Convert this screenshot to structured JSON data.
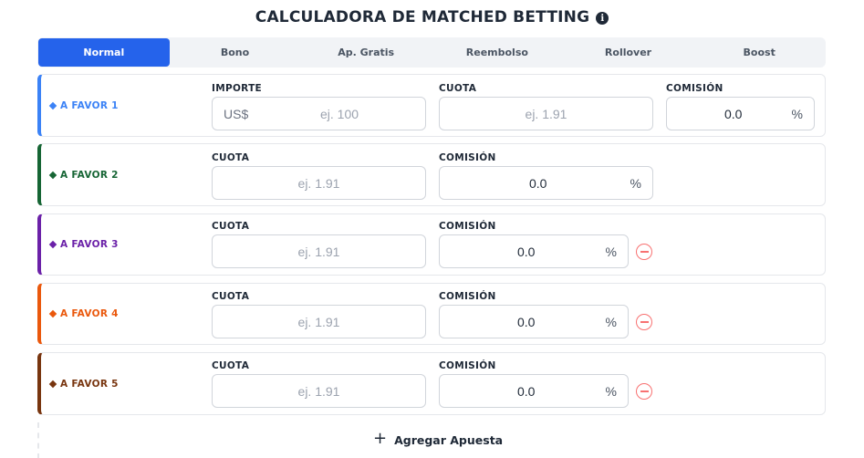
{
  "header": {
    "title": "CALCULADORA DE MATCHED BETTING",
    "info_icon": "info-icon"
  },
  "tabs": [
    {
      "label": "Normal",
      "active": true
    },
    {
      "label": "Bono",
      "active": false
    },
    {
      "label": "Ap. Gratis",
      "active": false
    },
    {
      "label": "Reembolso",
      "active": false
    },
    {
      "label": "Rollover",
      "active": false
    },
    {
      "label": "Boost",
      "active": false
    }
  ],
  "rows": [
    {
      "label": "A FAVOR 1",
      "color": "#3b82f6",
      "labels": {
        "importe": "IMPORTE",
        "cuota": "CUOTA",
        "comision": "COMISIÓN"
      },
      "currency": "US$",
      "importe_placeholder": "ej. 100",
      "cuota_placeholder": "ej. 1.91",
      "comision_value": "0.0",
      "pct": "%"
    },
    {
      "label": "A FAVOR 2",
      "color": "#166534",
      "labels": {
        "cuota": "CUOTA",
        "comision": "COMISIÓN"
      },
      "cuota_placeholder": "ej. 1.91",
      "comision_value": "0.0",
      "pct": "%"
    },
    {
      "label": "A FAVOR 3",
      "color": "#6b21a8",
      "labels": {
        "cuota": "CUOTA",
        "comision": "COMISIÓN"
      },
      "cuota_placeholder": "ej. 1.91",
      "comision_value": "0.0",
      "pct": "%"
    },
    {
      "label": "A FAVOR 4",
      "color": "#ea580c",
      "labels": {
        "cuota": "CUOTA",
        "comision": "COMISIÓN"
      },
      "cuota_placeholder": "ej. 1.91",
      "comision_value": "0.0",
      "pct": "%"
    },
    {
      "label": "A FAVOR 5",
      "color": "#78350f",
      "labels": {
        "cuota": "CUOTA",
        "comision": "COMISIÓN"
      },
      "cuota_placeholder": "ej. 1.91",
      "comision_value": "0.0",
      "pct": "%"
    }
  ],
  "add_button": {
    "label": "Agregar Apuesta",
    "icon": "plus-icon"
  },
  "colors": {
    "accent": "#2563eb",
    "remove": "#f87171"
  }
}
